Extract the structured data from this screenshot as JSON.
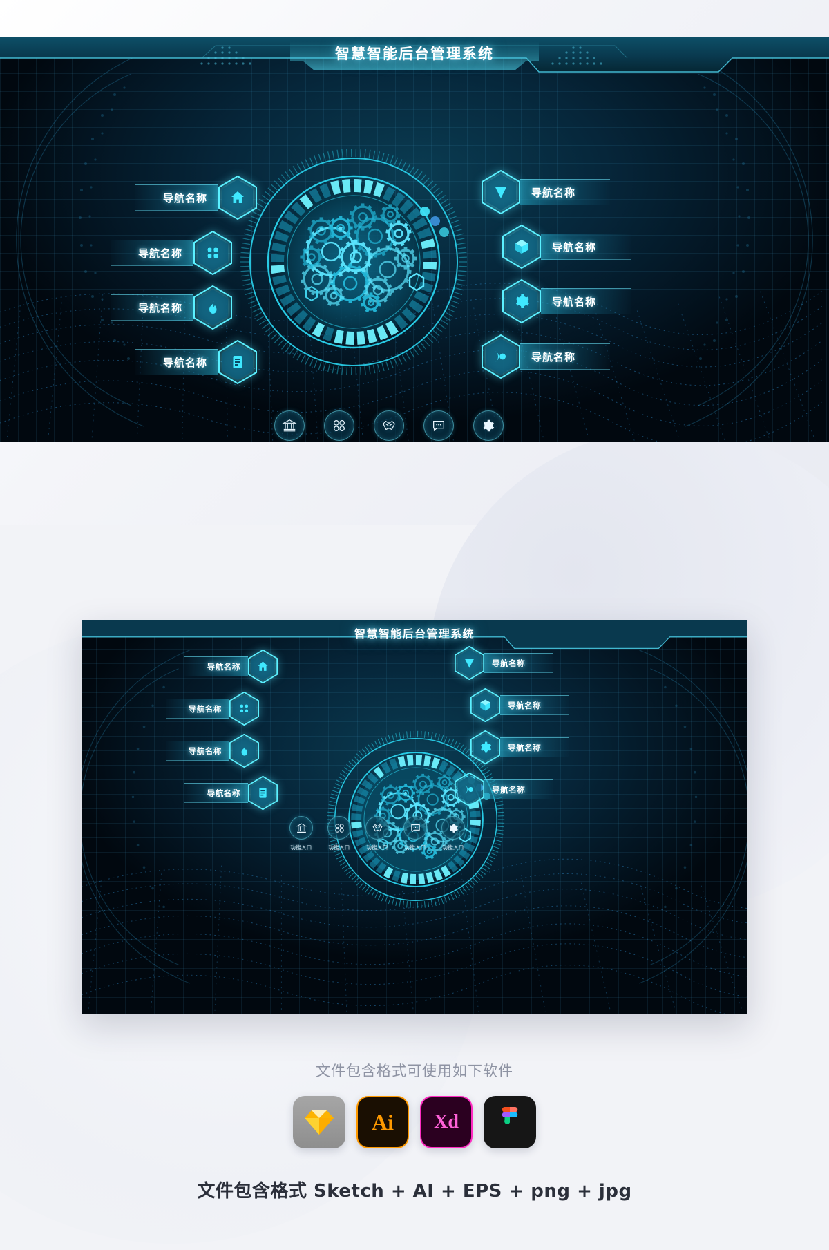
{
  "header": {
    "title": "智慧智能后台管理系统"
  },
  "nav_left": [
    {
      "label": "导航名称",
      "icon": "home-icon"
    },
    {
      "label": "导航名称",
      "icon": "clover-grid-icon"
    },
    {
      "label": "导航名称",
      "icon": "flame-icon"
    },
    {
      "label": "导航名称",
      "icon": "document-icon"
    }
  ],
  "nav_right": [
    {
      "label": "导航名称",
      "icon": "triangle-down-icon"
    },
    {
      "label": "导航名称",
      "icon": "cube-icon"
    },
    {
      "label": "导航名称",
      "icon": "gear-icon"
    },
    {
      "label": "导航名称",
      "icon": "play-circle-icon"
    }
  ],
  "function_entries": [
    {
      "label": "功能入口",
      "icon": "bank-icon"
    },
    {
      "label": "功能入口",
      "icon": "clover-grid-icon"
    },
    {
      "label": "功能入口",
      "icon": "handshake-icon"
    },
    {
      "label": "功能入口",
      "icon": "chat-bubble-icon"
    },
    {
      "label": "功能入口",
      "icon": "gear-icon"
    }
  ],
  "footer": {
    "software_title": "文件包含格式可使用如下软件",
    "formats_line": "文件包含格式 Sketch + AI + EPS + png + jpg",
    "logos": [
      {
        "name": "sketch-logo",
        "label": "Sketch"
      },
      {
        "name": "illustrator-logo",
        "label": "Ai"
      },
      {
        "name": "xd-logo",
        "label": "Xd"
      },
      {
        "name": "figma-logo",
        "label": "Figma"
      }
    ]
  },
  "colors": {
    "accent_cyan": "#5bf0ff",
    "deep_bg": "#01080f",
    "panel_teal": "#0a3c52",
    "label_white": "#ffffff",
    "footer_grey": "#8e93a3",
    "footer_dark": "#2b2f3a"
  }
}
